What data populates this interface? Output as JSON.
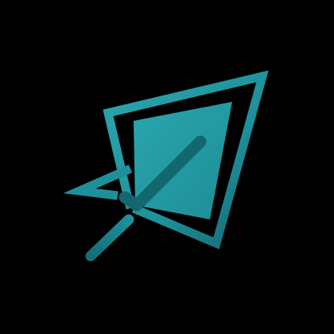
{
  "image": {
    "kind": "logo",
    "icon_name": "paper-plane-check-logo-icon",
    "background_color": "#000000",
    "colors": {
      "teal_light": "#2aa6ae",
      "teal_mid": "#1e8e97",
      "teal_dark": "#14666f"
    }
  }
}
